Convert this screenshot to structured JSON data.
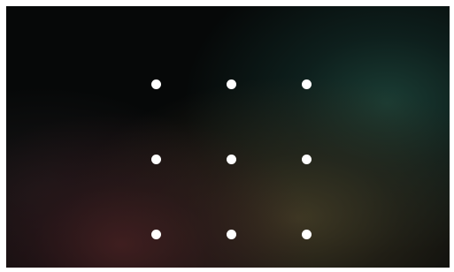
{
  "screen": {
    "type": "pattern-lock",
    "background": {
      "base_color": "#060808",
      "accent_colors": [
        "#1e463c",
        "#484028",
        "#462022"
      ]
    },
    "pattern_grid": {
      "rows": 3,
      "columns": 3,
      "dot_color": "#ffffff",
      "dots": [
        {
          "id": 1
        },
        {
          "id": 2
        },
        {
          "id": 3
        },
        {
          "id": 4
        },
        {
          "id": 5
        },
        {
          "id": 6
        },
        {
          "id": 7
        },
        {
          "id": 8
        },
        {
          "id": 9
        }
      ]
    }
  }
}
